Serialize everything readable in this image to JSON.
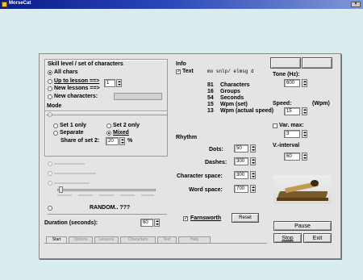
{
  "window": {
    "title": "MorseCat"
  },
  "skill": {
    "heading": "Skill level / set of characters",
    "all_chars": "All chars",
    "up_to": "Up to lesson ==>",
    "new_lessons": "New lessons ==>",
    "lesson_value": "1",
    "new_characters": "New characters:"
  },
  "mode": {
    "heading": "Mode",
    "set1": "Set 1 only",
    "set2": "Set 2 only",
    "separate": "Separate",
    "mixed": "Mixed",
    "share_label": "Share of set 2:",
    "share_value": "20",
    "percent": "%"
  },
  "random": {
    "label": "RANDOM.. ???"
  },
  "duration": {
    "label": "Duration (seconds):",
    "value": "60"
  },
  "info": {
    "heading": "Info",
    "text_label": "Text",
    "text_value": "mo snlp/ elmsg d",
    "rows": [
      {
        "num": "81",
        "label": "Characters"
      },
      {
        "num": "16",
        "label": "Groups"
      },
      {
        "num": "54",
        "label": "Seconds"
      },
      {
        "num": "15",
        "label": "Wpm (set)"
      },
      {
        "num": "13",
        "label": "Wpm (actual speed)"
      }
    ]
  },
  "rhythm": {
    "heading": "Rhythm",
    "dots_label": "Dots:",
    "dots_value": "50",
    "dashes_label": "Dashes:",
    "dashes_value": "300",
    "char_space_label": "Character space:",
    "char_space_value": "300",
    "word_space_label": "Word space:",
    "word_space_value": "700"
  },
  "farnsworth": "Farnsworth",
  "reset_label": "Reset",
  "tone": {
    "label": "Tone (Hz):",
    "value": "600"
  },
  "speed": {
    "label": "Speed:",
    "unit": "(Wpm)",
    "value": "15"
  },
  "var_max": {
    "label": "Var. max:",
    "value": "3"
  },
  "v_interval": {
    "label": "V.-interval",
    "value": "60"
  },
  "buttons": {
    "pause": "Pause",
    "stop": "Stop",
    "exit": "Exit"
  },
  "tabs": [
    "Start",
    "Options",
    "Lessons",
    "Characters",
    "Text",
    "Help"
  ]
}
